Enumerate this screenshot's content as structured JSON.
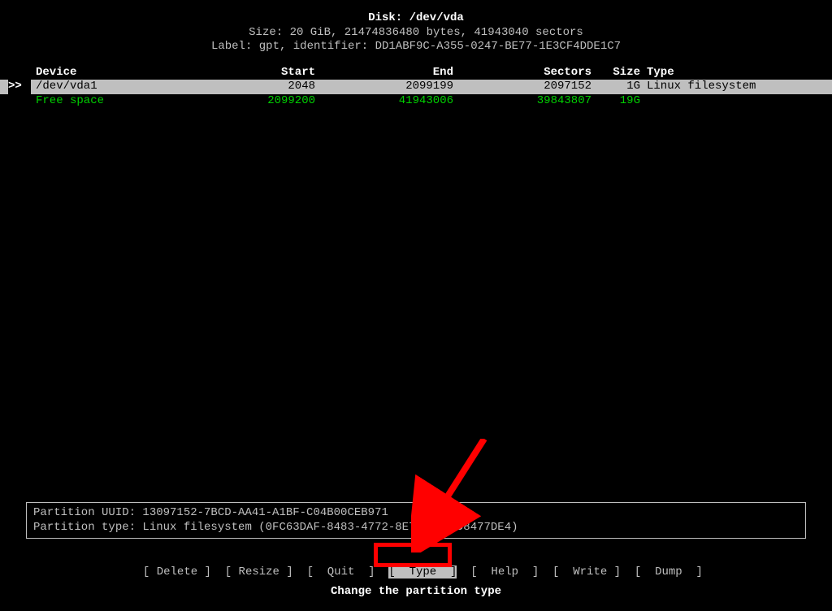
{
  "header": {
    "disk_line": "Disk: /dev/vda",
    "size_line": "Size: 20 GiB, 21474836480 bytes, 41943040 sectors",
    "label_line": "Label: gpt, identifier: DD1ABF9C-A355-0247-BE77-1E3CF4DDE1C7"
  },
  "columns": {
    "device": "Device",
    "start": "Start",
    "end": "End",
    "sectors": "Sectors",
    "size": "Size",
    "type": "Type"
  },
  "rows": [
    {
      "marker": ">>",
      "device": "/dev/vda1",
      "start": "2048",
      "end": "2099199",
      "sectors": "2097152",
      "size": "1G",
      "type": "Linux filesystem",
      "selected": true,
      "free": false
    },
    {
      "marker": "",
      "device": "Free space",
      "start": "2099200",
      "end": "41943006",
      "sectors": "39843807",
      "size": "19G",
      "type": "",
      "selected": false,
      "free": true
    }
  ],
  "info": {
    "uuid_line": "Partition UUID: 13097152-7BCD-AA41-A1BF-C04B00CEB971",
    "type_line": "Partition type: Linux filesystem (0FC63DAF-8483-4772-8E79-3D69D8477DE4)"
  },
  "menu": {
    "items": [
      {
        "label": "[ Delete ]",
        "selected": false
      },
      {
        "label": "[ Resize ]",
        "selected": false
      },
      {
        "label": "[  Quit  ]",
        "selected": false
      },
      {
        "label": "[  Type  ]",
        "selected": true
      },
      {
        "label": "[  Help  ]",
        "selected": false
      },
      {
        "label": "[  Write ]",
        "selected": false
      },
      {
        "label": "[  Dump  ]",
        "selected": false
      }
    ]
  },
  "help_text": "Change the partition type",
  "annotation": {
    "color": "#ff0000"
  }
}
